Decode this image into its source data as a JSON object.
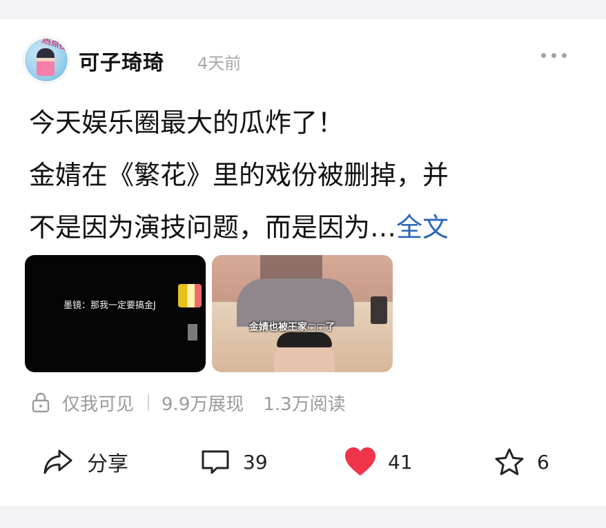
{
  "post": {
    "username": "可子琦琦",
    "time": "4天前",
    "avatar_badge": "热点榜",
    "content_lines": [
      "今天娱乐圈最大的瓜炸了！",
      "金婧在《繁花》里的戏份被删掉，并",
      "不是因为演技问题，而是因为…"
    ],
    "full_text_link": "全文",
    "images": [
      {
        "caption": "墨镜：那我一定要搞金J"
      },
      {
        "caption": "金婧也被王家▢▢了"
      }
    ],
    "visibility": "仅我可见",
    "impressions": "9.9万展现",
    "reads": "1.3万阅读"
  },
  "actions": {
    "share_label": "分享",
    "comment_count": "39",
    "like_count": "41",
    "favorite_count": "6"
  },
  "colors": {
    "link": "#2b66b9",
    "like": "#f0344a",
    "meta": "#9a9a9a"
  }
}
